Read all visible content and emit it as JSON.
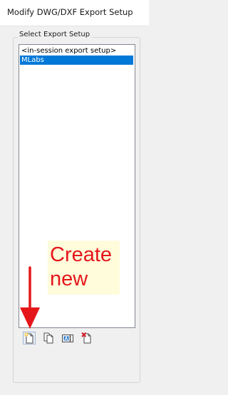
{
  "window": {
    "title": "Modify DWG/DXF Export Setup"
  },
  "export_setup": {
    "group_label": "Select Export Setup",
    "items": [
      {
        "label": "<in-session export setup>",
        "selected": false
      },
      {
        "label": "MLabs",
        "selected": true
      }
    ]
  },
  "toolbar": {
    "buttons": [
      {
        "icon": "new-setup-icon",
        "tooltip": ""
      },
      {
        "icon": "duplicate-setup-icon",
        "tooltip": ""
      },
      {
        "icon": "rename-setup-icon",
        "tooltip": ""
      },
      {
        "icon": "delete-setup-icon",
        "tooltip": ""
      }
    ]
  },
  "annotation": {
    "line1": "Create",
    "line2": "new",
    "color": "#e5161a"
  },
  "colors": {
    "selection": "#0078d7",
    "annotation_bg": "#fffcdc",
    "annotation_text": "#e5161a"
  }
}
